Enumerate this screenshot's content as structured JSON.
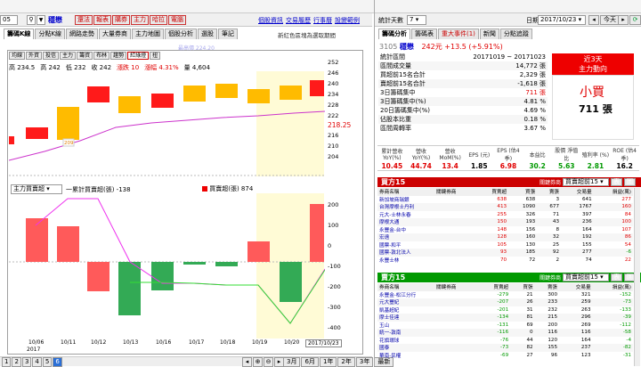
{
  "toolbar": {
    "stock_code": "05",
    "stock_name": "穩懋",
    "buttons": [
      "還法",
      "報表",
      "購券",
      "主力",
      "哈拉",
      "電腦"
    ],
    "links": [
      "個股資訊",
      "交易履歷",
      "行事曆",
      "設變範例"
    ]
  },
  "left_tabs": [
    "籌碼K線",
    "分點K線",
    "網路走勢",
    "大量券商",
    "主力地圖",
    "個股分析",
    "選股",
    "筆記"
  ],
  "left_note": "新紅色區塊為選取期間",
  "sub_tabs": [
    "均線",
    "外資",
    "投信",
    "主力",
    "籌資",
    "布林",
    "趨勢",
    "紅綠燈",
    "扭"
  ],
  "ohlc": {
    "high": "高 234.5",
    "close": "高 242",
    "low": "低 232",
    "open": "收 242",
    "change": "漲跌 10",
    "pct": "漲幅 4.31%",
    "vol": "量 4,604"
  },
  "top_annotation": "最高價 224.20",
  "price_axis": [
    "252",
    "246",
    "240",
    "234",
    "228",
    "222",
    "218.25",
    "216",
    "210",
    "204"
  ],
  "price_label_209": "209",
  "lower_select": "主力買賣超",
  "lower_legend": {
    "line": "一累計買賣超(張) -138",
    "bar": "買賣超(張) 874"
  },
  "lower_axis": [
    "200",
    "100",
    "0",
    "-100",
    "-200",
    "-300",
    "-400"
  ],
  "dates": [
    "10/06",
    "10/11",
    "10/12",
    "10/13",
    "10/16",
    "10/17",
    "10/18",
    "10/19",
    "10/20",
    "2017/10/23"
  ],
  "year_label": "2017",
  "bottom_nav": [
    "1",
    "2",
    "3",
    "4",
    "5",
    "6"
  ],
  "bottom_range": [
    "3月",
    "6月",
    "1年",
    "2年",
    "3年",
    "最新"
  ],
  "right_toolbar": {
    "label": "統計天數",
    "days": "7",
    "date_label": "日期",
    "date": "2017/10/23",
    "today": "今天",
    "refresh": "更新"
  },
  "right_tabs": [
    "籌碼分析",
    "籌碼表",
    "重大事件(1)",
    "新聞",
    "分點追蹤"
  ],
  "quote": {
    "code": "3105",
    "name": "穩懋",
    "price": "242元",
    "change": "+13.5 (+5.91%)"
  },
  "stats": [
    {
      "label": "統計區間",
      "value": "20171019 ~ 20171023",
      "cls": ""
    },
    {
      "label": "區間成交量",
      "value": "14,772 張",
      "cls": ""
    },
    {
      "label": "買超前15名合計",
      "value": "2,329 張",
      "cls": ""
    },
    {
      "label": "賣超前15名合計",
      "value": "-1,618 張",
      "cls": ""
    },
    {
      "label": "3日籌碼集中",
      "value": "711 張",
      "cls": "red"
    },
    {
      "label": "3日籌碼集中(%)",
      "value": "4.81 %",
      "cls": ""
    },
    {
      "label": "20日籌碼集中(%)",
      "value": "4.69 %",
      "cls": ""
    },
    {
      "label": "佔股本比重",
      "value": "0.18 %",
      "cls": ""
    },
    {
      "label": "區間周轉率",
      "value": "3.67 %",
      "cls": ""
    }
  ],
  "trend_box": {
    "title": "近3天",
    "subtitle": "主力動向",
    "verdict": "小買",
    "amount": "711 張"
  },
  "indicators": {
    "heads": [
      "累計營收 YoY(%)",
      "營收 YoY(%)",
      "營收 MoM(%)",
      "EPS (元)",
      "EPS (估4季)",
      "本益比",
      "股價 淨值比",
      "殖利率 (%)",
      "ROE (估4季)"
    ],
    "vals": [
      "10.45",
      "44.74",
      "13.4",
      "1.85",
      "6.98",
      "30.2",
      "5.63",
      "2.81",
      "16.2"
    ]
  },
  "buy": {
    "title": "買方15",
    "select": "關鍵券商",
    "period": "買賣超前15",
    "heads": [
      "券商名稱",
      "關鍵券商",
      "買賣超",
      "買張",
      "賣張",
      "交易量",
      "損益(萬)"
    ],
    "rows": [
      [
        "新加坡商瑞銀",
        "",
        "638",
        "638",
        "3",
        "641",
        "277"
      ],
      [
        "台灣摩根士丹利",
        "",
        "413",
        "1090",
        "677",
        "1767",
        "160"
      ],
      [
        "元大-士林永春",
        "",
        "255",
        "326",
        "71",
        "397",
        "84"
      ],
      [
        "摩根大通",
        "",
        "150",
        "193",
        "43",
        "236",
        "100"
      ],
      [
        "永豐金-台中",
        "",
        "148",
        "156",
        "8",
        "164",
        "107"
      ],
      [
        "宏遠",
        "",
        "128",
        "160",
        "32",
        "192",
        "86"
      ],
      [
        "國票-和平",
        "",
        "105",
        "130",
        "25",
        "155",
        "54"
      ],
      [
        "國票-敦北法人",
        "",
        "93",
        "185",
        "92",
        "277",
        "-6"
      ],
      [
        "永豐士林",
        "",
        "70",
        "72",
        "2",
        "74",
        "22"
      ]
    ]
  },
  "sell": {
    "title": "賣方15",
    "select": "關鍵券商",
    "period": "買賣超前15",
    "heads": [
      "券商名稱",
      "關鍵券商",
      "買賣超",
      "買張",
      "賣張",
      "交易量",
      "損益(萬)"
    ],
    "rows": [
      [
        "永豐金-松江分行",
        "",
        "-279",
        "21",
        "300",
        "321",
        "-152"
      ],
      [
        "元大豐紀",
        "",
        "-207",
        "26",
        "233",
        "259",
        "-73"
      ],
      [
        "凱基超紀",
        "",
        "-201",
        "31",
        "232",
        "263",
        "-133"
      ],
      [
        "摩士佳達",
        "",
        "-134",
        "81",
        "215",
        "296",
        "-39"
      ],
      [
        "玉山",
        "",
        "-131",
        "69",
        "200",
        "269",
        "-112"
      ],
      [
        "統一-敦南",
        "",
        "-116",
        "0",
        "116",
        "116",
        "-58"
      ],
      [
        "花旗環球",
        "",
        "-76",
        "44",
        "120",
        "164",
        "-4"
      ],
      [
        "國泰",
        "",
        "-73",
        "82",
        "155",
        "237",
        "-82"
      ],
      [
        "華南-民權",
        "",
        "-69",
        "27",
        "96",
        "123",
        "-31"
      ]
    ]
  }
}
